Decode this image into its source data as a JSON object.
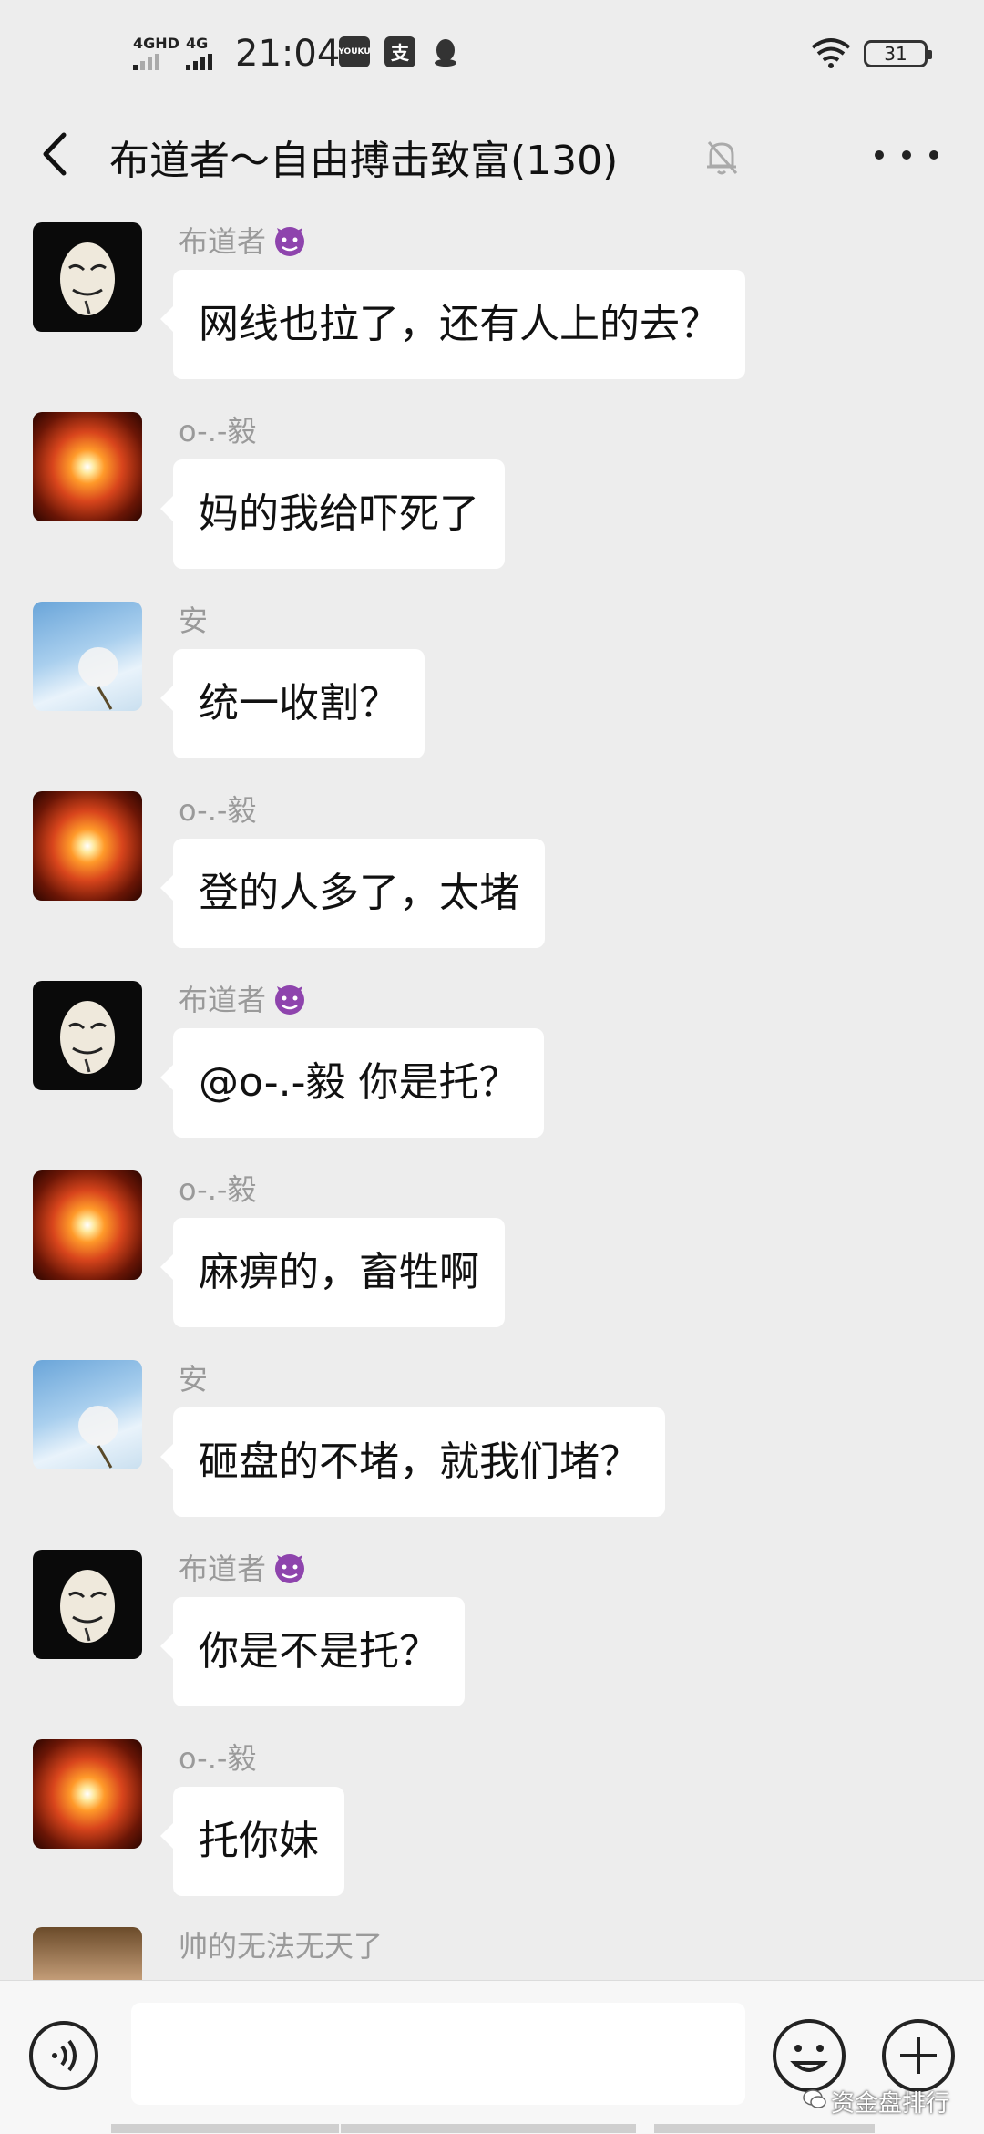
{
  "status_bar": {
    "sig1": "4GHD",
    "sig2": "4G",
    "time": "21:04",
    "app_youku": "YOUKU",
    "battery": "31"
  },
  "header": {
    "title": "布道者～自由搏击致富(130)"
  },
  "messages": [
    {
      "sender": "布道者",
      "text": "网线也拉了，还有人上的去？",
      "avatar": "mask-avatar"
    },
    {
      "sender": "o-.-毅",
      "text": "妈的我给吓死了",
      "avatar": "burst-avatar"
    },
    {
      "sender": "安",
      "text": "统一收割？",
      "avatar": "dandelion-avatar"
    },
    {
      "sender": "o-.-毅",
      "text": "登的人多了，太堵",
      "avatar": "burst-avatar"
    },
    {
      "sender": "布道者",
      "text": "@o-.-毅 你是托？",
      "avatar": "mask-avatar"
    },
    {
      "sender": "o-.-毅",
      "text": "麻痹的，畜牲啊",
      "avatar": "burst-avatar"
    },
    {
      "sender": "安",
      "text": "砸盘的不堵，就我们堵？",
      "avatar": "dandelion-avatar"
    },
    {
      "sender": "布道者",
      "text": "你是不是托？",
      "avatar": "mask-avatar"
    },
    {
      "sender": "o-.-毅",
      "text": "托你妹",
      "avatar": "burst-avatar"
    },
    {
      "sender": "帅的无法无天了",
      "text": "",
      "avatar": "face-avatar"
    }
  ],
  "input": {
    "value": "",
    "placeholder": ""
  },
  "watermark": "资金盘排行",
  "colors": {
    "background": "#ededed",
    "bubble": "#ffffff",
    "sender_name": "#9a9a9a",
    "devil_emoji": "#8e44ad"
  }
}
